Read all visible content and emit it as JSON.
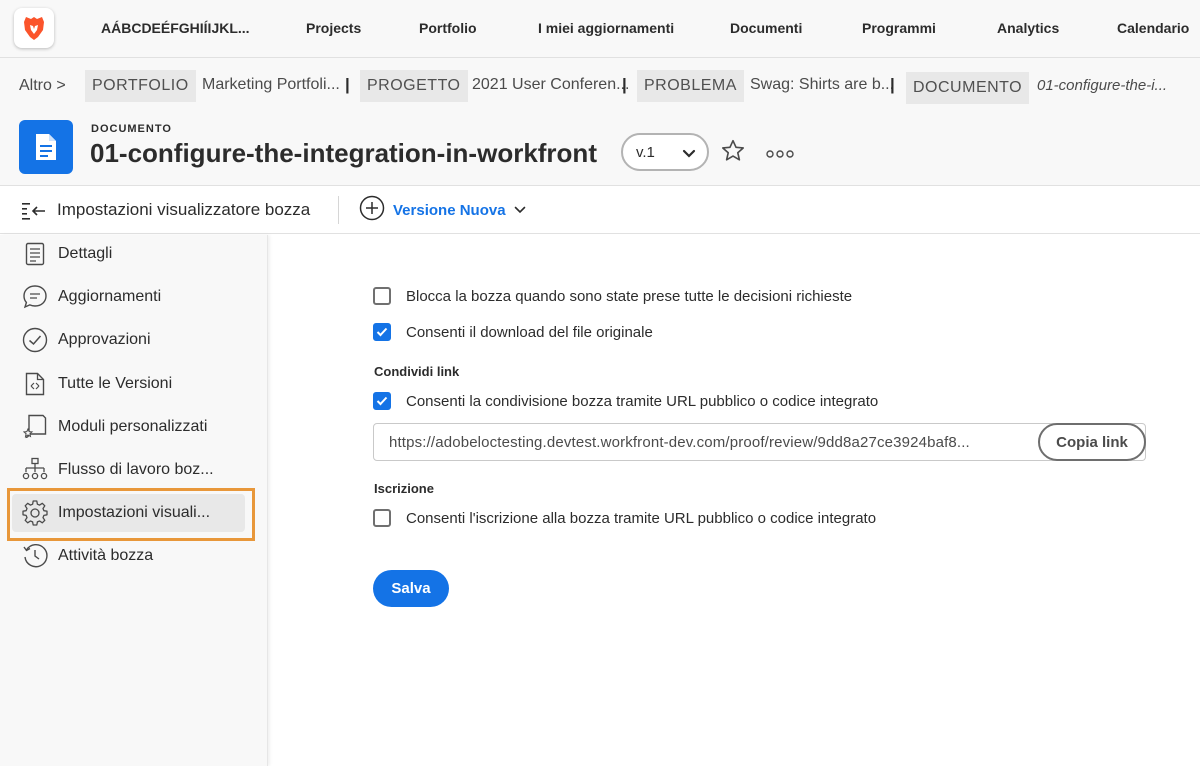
{
  "colors": {
    "accent": "#1473e6",
    "highlight": "#e8973a",
    "brand_logo": "#fb542b"
  },
  "topnav": {
    "logo_icon": "brave-lion-icon",
    "workspace": "AÁBCDEÉFGHIÍIJKL...",
    "items": [
      "Projects",
      "Portfolio",
      "I miei aggiornamenti",
      "Documenti",
      "Programmi",
      "Analytics",
      "Calendario"
    ]
  },
  "breadcrumb": {
    "altro": "Altro >",
    "items": [
      {
        "tag": "PORTFOLIO",
        "name": "Marketing Portfoli..."
      },
      {
        "tag": "PROGETTO",
        "name": "2021 User Conferen..."
      },
      {
        "tag": "PROBLEMA",
        "name": "Swag: Shirts are b..."
      },
      {
        "tag": "DOCUMENTO",
        "name": "01-configure-the-i..."
      }
    ],
    "separator": "|"
  },
  "header": {
    "object_type": "DOCUMENTO",
    "title": "01-configure-the-integration-in-workfront",
    "version": "v.1",
    "doc_icon": "document-icon",
    "star_icon": "star-icon",
    "more_icon": "more-icon"
  },
  "toolbar": {
    "title": "Impostazioni visualizzatore bozza",
    "new_version_label": "Versione Nuova"
  },
  "sidebar": {
    "items": [
      {
        "label": "Dettagli",
        "icon": "details-icon"
      },
      {
        "label": "Aggiornamenti",
        "icon": "comment-icon"
      },
      {
        "label": "Approvazioni",
        "icon": "checkmark-circle-icon"
      },
      {
        "label": "Tutte le Versioni",
        "icon": "versions-icon"
      },
      {
        "label": "Moduli personalizzati",
        "icon": "custom-forms-icon"
      },
      {
        "label": "Flusso di lavoro boz...",
        "icon": "workflow-icon"
      },
      {
        "label": "Impostazioni visuali...",
        "icon": "gear-icon",
        "active": true
      },
      {
        "label": "Attività bozza",
        "icon": "history-icon"
      }
    ]
  },
  "settings": {
    "lock_proof": {
      "label": "Blocca la bozza quando sono state prese tutte le decisioni richieste",
      "checked": false
    },
    "allow_download": {
      "label": "Consenti il download del file originale",
      "checked": true
    },
    "share_section": "Condividi link",
    "allow_share": {
      "label": "Consenti la condivisione bozza tramite URL pubblico o codice integrato",
      "checked": true
    },
    "share_url": "https://adobeloctesting.devtest.workfront-dev.com/proof/review/9dd8a27ce3924baf8...",
    "copy_link": "Copia link",
    "subscribe_section": "Iscrizione",
    "allow_subscribe": {
      "label": "Consenti l'iscrizione alla bozza tramite URL pubblico o codice integrato",
      "checked": false
    },
    "save": "Salva"
  }
}
